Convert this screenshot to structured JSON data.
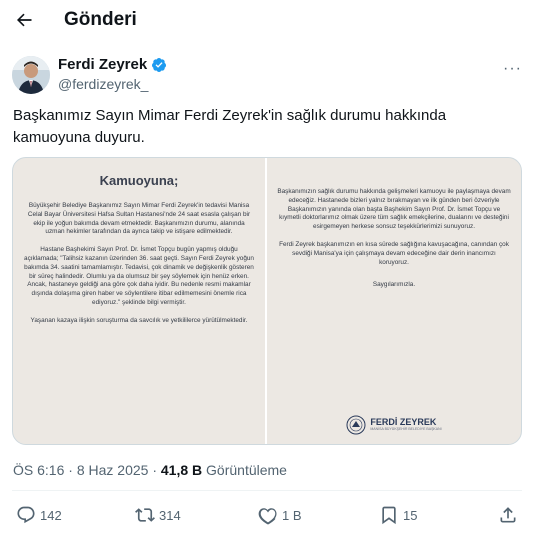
{
  "header": {
    "title": "Gönderi",
    "back_icon": "arrow-left-icon"
  },
  "author": {
    "name": "Ferdi Zeyrek",
    "handle": "@ferdizeyrek_",
    "verified_color": "#1d9bf0",
    "more": "···"
  },
  "tweet": {
    "text": "Başkanımız Sayın Mimar Ferdi Zeyrek'in sağlık durumu hakkında kamuoyuna duyuru."
  },
  "media": {
    "left": {
      "title": "Kamuoyuna;",
      "paragraph1": "Büyükşehir Belediye Başkanımız Sayın Mimar Ferdi Zeyrek'in tedavisi Manisa Celal Bayar Üniversitesi Hafsa Sultan Hastanesi'nde 24 saat esasla çalışan bir ekip ile yoğun bakımda devam etmektedir. Başkanımızın durumu, alanında uzman hekimler tarafından da ayrıca takip ve istişare edilmektedir.",
      "paragraph2": "Hastane Başhekimi Sayın Prof. Dr. İsmet Topçu bugün yapmış olduğu açıklamada; \"Talihsiz kazanın üzerinden 36. saat geçti. Sayın Ferdi Zeyrek yoğun bakımda 34. saatini tamamlamıştır. Tedavisi, çok dinamik ve değişkenlik gösteren bir süreç halindedir. Olumlu ya da olumsuz bir şey söylemek için henüz erken. Ancak, hastaneye geldiği ana göre çok daha iyidir. Bu nedenle resmi makamlar dışında dolaşıma giren haber ve söylentilere itibar edilmemesini önemle rica ediyoruz.\" şeklinde bilgi vermiştir.",
      "paragraph3": "Yaşanan kazaya ilişkin soruşturma da savcılık ve yetkililerce yürütülmektedir."
    },
    "right": {
      "paragraph1": "Başkanımızın sağlık durumu hakkında gelişmeleri kamuoyu ile paylaşmaya devam edeceğiz. Hastanede bizleri yalnız bırakmayan ve ilk günden beri özveriyle Başkanımızın yanında olan başta Başhekim Sayın Prof. Dr. İsmet Topçu ve kıymetli doktorlarımız olmak üzere tüm sağlık emekçilerine, dualarını ve desteğini esirgemeyen herkese sonsuz teşekkürlerimizi sunuyoruz.",
      "paragraph2": "Ferdi Zeyrek başkanımızın en kısa sürede sağlığına kavuşacağına, canından çok sevdiği Manisa'ya için çalışmaya devam edeceğine dair derin inancımızı koruyoruz.",
      "closing": "Saygılarımızla.",
      "sign_name": "FERDİ ZEYREK",
      "sign_sub": "MANİSA BÜYÜKŞEHİR BELEDİYE BAŞKANI"
    }
  },
  "meta": {
    "time": "ÖS 6:16",
    "date": "8 Haz 2025",
    "views_count": "41,8 B",
    "views_label": "Görüntüleme"
  },
  "actions": {
    "reply_count": "142",
    "repost_count": "314",
    "like_count": "1 B",
    "bookmark_count": "15"
  }
}
